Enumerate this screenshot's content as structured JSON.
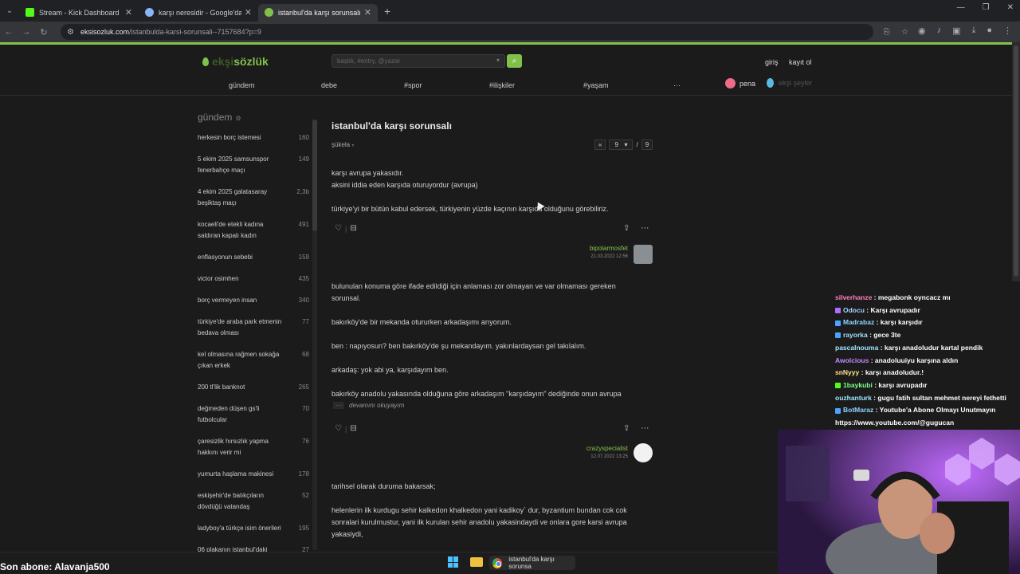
{
  "browser": {
    "tabs": [
      {
        "title": "Stream - Kick Dashboard",
        "favicon_color": "#53fc18",
        "active": false
      },
      {
        "title": "karşı neresidir - Google'da Ara",
        "favicon_color": "#8ab4f8",
        "active": false
      },
      {
        "title": "istanbul'da karşı sorunsalı - şa",
        "favicon_color": "#81c14b",
        "active": true
      }
    ],
    "url_host": "eksisozluk.com",
    "url_path": "/istanbulda-karsi-sorunsali--7157684?p=9"
  },
  "site": {
    "logo_faded": "ekşi",
    "logo_main": "sözlük",
    "search_placeholder": "başlık, #entry, @yazar",
    "login": "giriş",
    "register": "kayıt ol",
    "nav": [
      "gündem",
      "debe",
      "#spor",
      "#ilişkiler",
      "#yaşam",
      "···"
    ],
    "pena": "pena",
    "eksi_seyler": "ekşi şeyler"
  },
  "sidebar": {
    "title": "gündem",
    "topics": [
      {
        "label": "herkesin borç istemesi",
        "count": "160"
      },
      {
        "label": "5 ekim 2025 samsunspor fenerbahçe maçı",
        "count": "149"
      },
      {
        "label": "4 ekim 2025 galatasaray beşiktaş maçı",
        "count": "2,3b"
      },
      {
        "label": "kocaeli'de etekli kadına saldıran kapalı kadın",
        "count": "491"
      },
      {
        "label": "enflasyonun sebebi",
        "count": "159"
      },
      {
        "label": "victor osimhen",
        "count": "435"
      },
      {
        "label": "borç vermeyen insan",
        "count": "340"
      },
      {
        "label": "türkiye'de araba park etmenin bedava olması",
        "count": "77"
      },
      {
        "label": "kel olmasına rağmen sokağa çıkan erkek",
        "count": "68"
      },
      {
        "label": "200 tl'lik banknot",
        "count": "265"
      },
      {
        "label": "değmeden düşen gs'li futbolcular",
        "count": "70"
      },
      {
        "label": "çaresizlik hırsızlık yapma hakkını verir mi",
        "count": "76"
      },
      {
        "label": "yumurta haşlama makinesi",
        "count": "178"
      },
      {
        "label": "eskişehir'de balıkçıların dövdüğü vatandaş",
        "count": "52"
      },
      {
        "label": "ladyboy'a türkçe isim önerileri",
        "count": "195"
      },
      {
        "label": "06 plakanın istanbul'daki",
        "count": "27"
      }
    ]
  },
  "topic": {
    "title": "istanbul'da karşı sorunsalı",
    "sukela": "şükela",
    "page_current": "9",
    "page_total": "9",
    "page_sep": "/",
    "prev": "«"
  },
  "entries": [
    {
      "lines": [
        "karşı avrupa yakasıdır.",
        "aksini iddia eden karşıda oturuyordur (avrupa)",
        "",
        "türkiye'yi bir bütün kabul edersek, türkiyenin yüzde kaçının karşıda olduğunu görebiliriz."
      ],
      "author": "bipolarmosfet",
      "date": "21.03.2022 12:56"
    },
    {
      "lines": [
        "bulunulan konuma göre ifade edildiği için anlaması zor olmayan ve var olmaması gereken sorunsal.",
        "",
        "bakırköy'de bir mekanda otururken arkadaşımı arıyorum.",
        "",
        "ben : napıyosun? ben bakırköy'de şu mekandayım. yakınlardaysan gel takılalım.",
        "",
        "arkadaş: yok abi ya, karşıdayım ben.",
        "",
        "bakırköy anadolu yakasında olduğuna göre arkadaşım \"karşıdayım\" dediğinde onun avrupa"
      ],
      "more": "devamını okuyayım",
      "author": "crazyspecialist",
      "date": "12.07.2022 13:25"
    },
    {
      "lines": [
        "tarihsel olarak duruma bakarsak;",
        "",
        "helenlerin ilk kurdugu sehir kalkedon khalkedon yani kadikoy` dur, byzantium bundan cok cok sonralari kurulmustur, yani ilk kurulan sehir anadolu yakasindaydi ve onlara gore karsi avrupa yakasiydi,"
      ]
    }
  ],
  "chat": [
    {
      "user": "silverhanze",
      "color": "#ff7fbf",
      "badge": "",
      "msg": "megabonk oyncacz mı"
    },
    {
      "user": "Odocu",
      "color": "#9fd3ff",
      "badge": "#a970ff",
      "msg": "Karşı avrupadır"
    },
    {
      "user": "Madrabaz",
      "color": "#8fd3ff",
      "badge": "#4aa3ff",
      "msg": "karşı karşıdır"
    },
    {
      "user": "rayorka",
      "color": "#9fe0ff",
      "badge": "#4aa3ff",
      "msg": "gece 3te"
    },
    {
      "user": "pascalnouma",
      "color": "#9fe7ff",
      "badge": "",
      "msg": "karşı anadoludur kartal pendik"
    },
    {
      "user": "Awolcious",
      "color": "#c58bff",
      "badge": "",
      "msg": "anadoluuiyu karşına aldın"
    },
    {
      "user": "snNyyy",
      "color": "#ffe08a",
      "badge": "",
      "msg": "karşı anadoludur.!"
    },
    {
      "user": "1baykubi",
      "color": "#7dff8a",
      "badge": "#53fc18",
      "msg": "karşı avrupadır"
    },
    {
      "user": "ouzhanturk",
      "color": "#9fe7ff",
      "badge": "",
      "msg": "gugu fatih sultan mehmet nereyi fethetti"
    },
    {
      "user": "BotMaraz",
      "color": "#8fd3ff",
      "badge": "#4aa3ff",
      "msg": "Youtube'a Abone Olmayı Unutmayın"
    },
    {
      "user": "",
      "color": "#ffffff",
      "badge": "",
      "msg": "https://www.youtube.com/@gugucan"
    }
  ],
  "overlay": {
    "last_sub": "Son abone: Alavanja500"
  },
  "taskbar": {
    "chrome_label": "istanbul'da karşı sorunsa"
  },
  "colors": {
    "accent": "#81c14b",
    "background": "#1b1b1b"
  }
}
